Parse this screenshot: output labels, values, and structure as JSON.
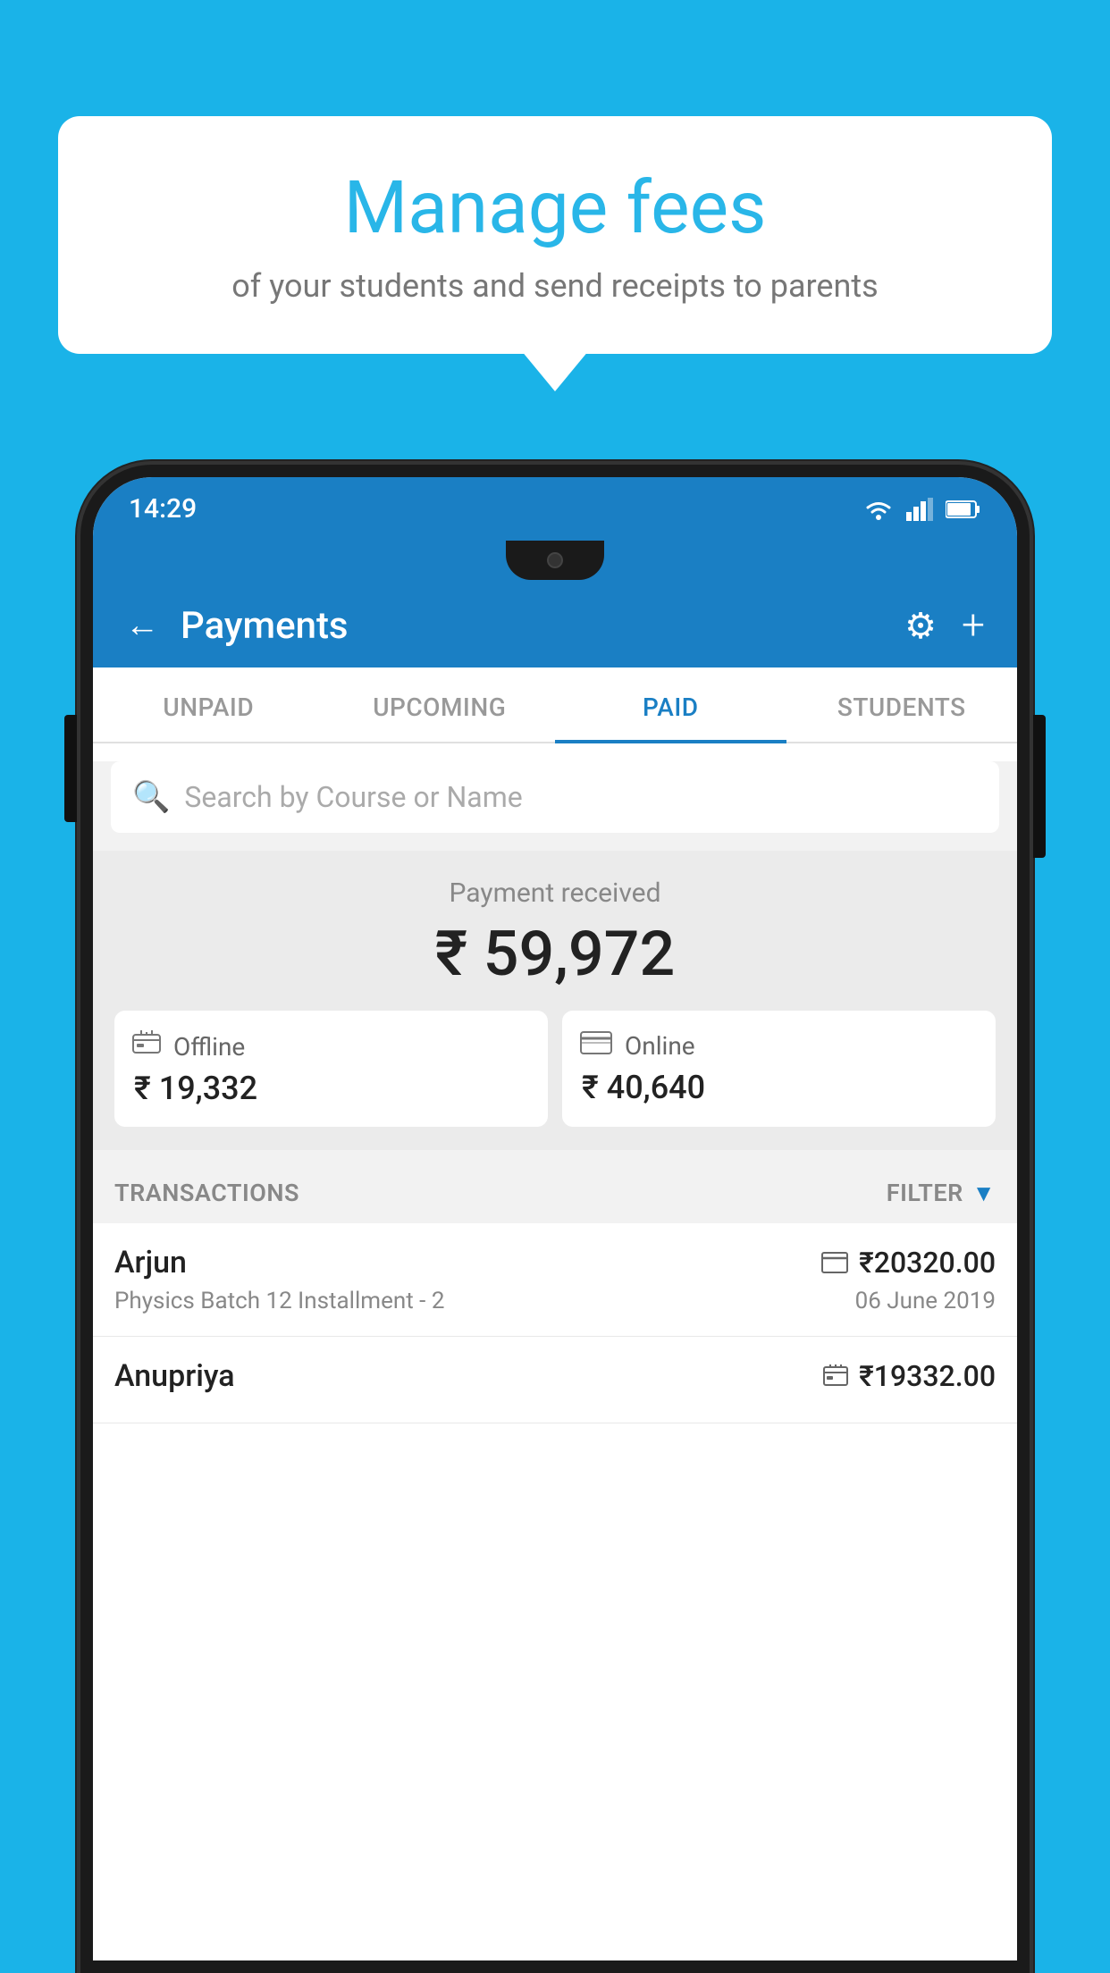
{
  "background_color": "#1ab3e8",
  "bubble": {
    "title": "Manage fees",
    "subtitle": "of your students and send receipts to parents"
  },
  "status_bar": {
    "time": "14:29"
  },
  "app_bar": {
    "title": "Payments",
    "back_label": "←",
    "settings_label": "⚙",
    "add_label": "+"
  },
  "tabs": [
    {
      "label": "UNPAID",
      "active": false
    },
    {
      "label": "UPCOMING",
      "active": false
    },
    {
      "label": "PAID",
      "active": true
    },
    {
      "label": "STUDENTS",
      "active": false
    }
  ],
  "search": {
    "placeholder": "Search by Course or Name"
  },
  "payment": {
    "label": "Payment received",
    "total": "₹ 59,972",
    "offline": {
      "label": "Offline",
      "amount": "₹ 19,332"
    },
    "online": {
      "label": "Online",
      "amount": "₹ 40,640"
    }
  },
  "transactions": {
    "label": "TRANSACTIONS",
    "filter_label": "FILTER",
    "items": [
      {
        "name": "Arjun",
        "amount": "₹20320.00",
        "course": "Physics Batch 12 Installment - 2",
        "date": "06 June 2019",
        "type": "online"
      },
      {
        "name": "Anupriya",
        "amount": "₹19332.00",
        "course": "",
        "date": "",
        "type": "offline"
      }
    ]
  }
}
